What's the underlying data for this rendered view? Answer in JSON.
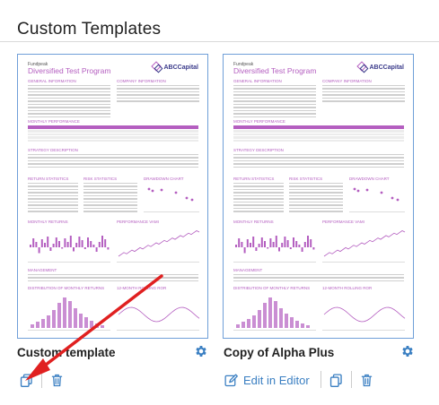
{
  "section": {
    "title": "Custom Templates"
  },
  "templates": [
    {
      "name": "Custom template",
      "preview": {
        "fund_label": "Fundpeak",
        "fund_title": "Diversified Test Program",
        "brand": "ABCCapital",
        "sections": [
          "GENERAL INFORMATION",
          "COMPANY INFORMATION",
          "MONTHLY PERFORMANCE",
          "STRATEGY DESCRIPTION",
          "RETURN STATISTICS",
          "RISK STATISTICS",
          "DRAWDOWN CHART",
          "MONTHLY RETURNS",
          "PERFORMANCE VAMI",
          "MANAGEMENT",
          "DISTRIBUTION OF MONTHLY RETURNS",
          "12-MONTH ROLLING ROR"
        ]
      },
      "actions": {
        "settings_icon": "gear-icon",
        "copy_icon": "copy-icon",
        "delete_icon": "trash-icon"
      }
    },
    {
      "name": "Copy of Alpha Plus",
      "preview": {
        "fund_label": "Fundpeak",
        "fund_title": "Diversified Test Program",
        "brand": "ABCCapital",
        "sections": [
          "GENERAL INFORMATION",
          "COMPANY INFORMATION",
          "MONTHLY PERFORMANCE",
          "STRATEGY DESCRIPTION",
          "RETURN STATISTICS",
          "RISK STATISTICS",
          "DRAWDOWN CHART",
          "MONTHLY RETURNS",
          "PERFORMANCE VAMI",
          "MANAGEMENT",
          "DISTRIBUTION OF MONTHLY RETURNS",
          "12-MONTH ROLLING ROR"
        ]
      },
      "actions": {
        "edit_label": "Edit in Editor",
        "settings_icon": "gear-icon",
        "edit_icon": "edit-icon",
        "copy_icon": "copy-icon",
        "delete_icon": "trash-icon"
      }
    }
  ],
  "annotation": {
    "type": "arrow",
    "color": "#e02020",
    "points_to": "copy-icon"
  },
  "colors": {
    "accent": "#3a7fc2",
    "brand_purple": "#b45ec0",
    "thumb_border": "#6f9fd8",
    "arrow": "#e02020"
  }
}
